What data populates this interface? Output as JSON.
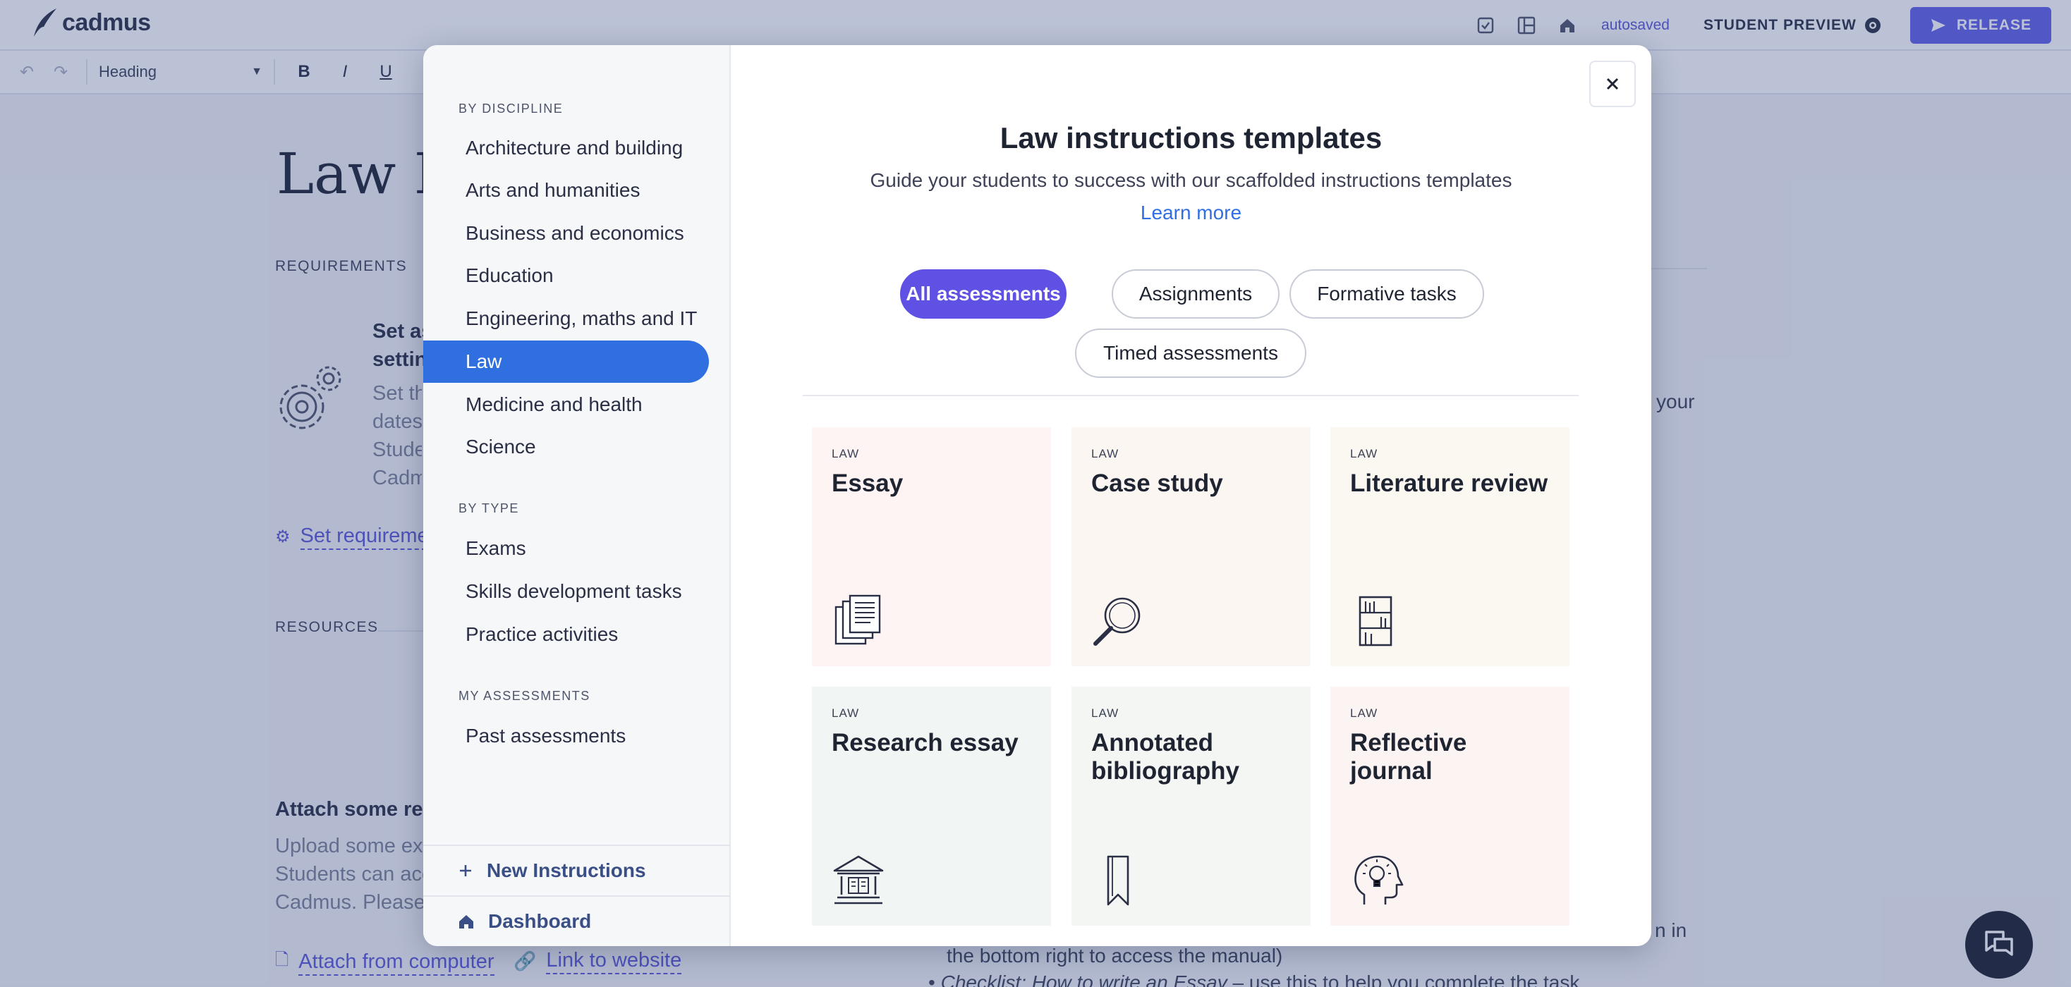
{
  "app": {
    "brand": "cadmus",
    "autosaved": "autosaved",
    "student_preview": "STUDENT PREVIEW",
    "release": "RELEASE"
  },
  "editor": {
    "heading_select": "Heading",
    "bold": "B",
    "italic": "I",
    "underline": "U"
  },
  "document": {
    "title": "Law P",
    "requirements_label": "REQUIREMENTS",
    "requirements_title_lines": [
      "Set as",
      "settin"
    ],
    "requirements_body_lines": [
      "Set th",
      "dates",
      "Stude",
      "Cadm"
    ],
    "set_requirements_link": "Set requireme",
    "resources_label": "RESOURCES",
    "attach_title": "Attach some res",
    "attach_body_lines": [
      "Upload some ext",
      "Students can acc",
      "Cadmus. Please"
    ],
    "attach_computer": "Attach from computer",
    "link_website": "Link to website",
    "right_fragment_1": "your",
    "right_fragment_2": "n in",
    "right_line_1": "the bottom right to access the manual)",
    "right_line_2_italic": "Checklist: How to write an Essay",
    "right_line_2_rest": " – use this to help you complete the task"
  },
  "modal": {
    "title": "Law instructions templates",
    "subtitle": "Guide your students to success with our scaffolded instructions templates",
    "learn_more": "Learn more",
    "filters": [
      {
        "label": "All assessments",
        "active": true
      },
      {
        "label": "Assignments",
        "active": false
      },
      {
        "label": "Formative tasks",
        "active": false
      },
      {
        "label": "Timed assessments",
        "active": false
      }
    ],
    "sidebar": {
      "discipline_heading": "BY DISCIPLINE",
      "disciplines": [
        "Architecture and building",
        "Arts and humanities",
        "Business and economics",
        "Education",
        "Engineering, maths and IT",
        "Law",
        "Medicine and health",
        "Science"
      ],
      "active_discipline": "Law",
      "type_heading": "BY TYPE",
      "types": [
        "Exams",
        "Skills development tasks",
        "Practice activities"
      ],
      "my_heading": "MY ASSESSMENTS",
      "my_items": [
        "Past assessments"
      ],
      "new_instructions": "New Instructions",
      "dashboard": "Dashboard"
    },
    "cards": [
      {
        "tag": "LAW",
        "title": "Essay",
        "icon": "documents-icon",
        "bg": "#fdf4f3"
      },
      {
        "tag": "LAW",
        "title": "Case study",
        "icon": "magnifier-icon",
        "bg": "#fcf6f2"
      },
      {
        "tag": "LAW",
        "title": "Literature review",
        "icon": "bookshelf-icon",
        "bg": "#fbf8f1"
      },
      {
        "tag": "LAW",
        "title": "Research essay",
        "icon": "library-icon",
        "bg": "#f1f5f3"
      },
      {
        "tag": "LAW",
        "title": "Annotated bibliography",
        "icon": "bookmark-icon",
        "bg": "#f3f6f2"
      },
      {
        "tag": "LAW",
        "title": "Reflective journal",
        "icon": "lightbulb-head-icon",
        "bg": "#fcf4f3"
      }
    ]
  },
  "colors": {
    "accent_purple": "#5e51e3",
    "active_blue": "#2f6fe0",
    "link_purple": "#5b57d6"
  }
}
